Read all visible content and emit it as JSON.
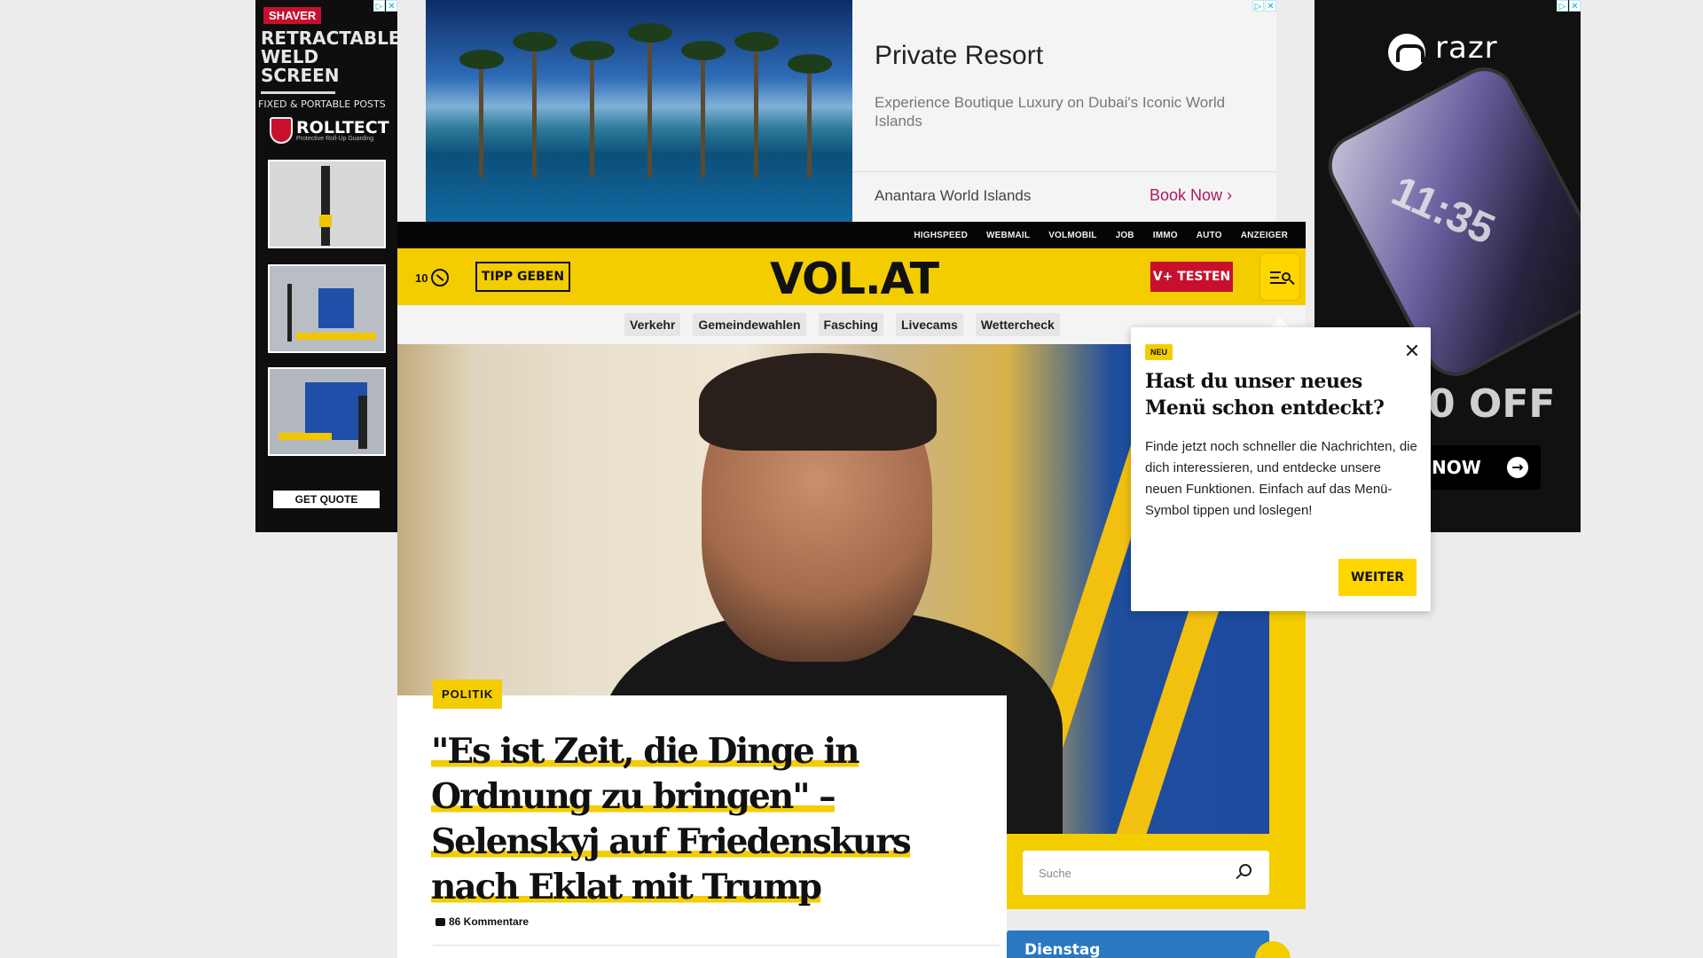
{
  "left_ad": {
    "brand": "SHAVER",
    "headline": "RETRACTABLE WELD SCREEN",
    "subline": "FIXED & PORTABLE POSTS",
    "logo": "ROLLTECT",
    "logo_tag": "Protective Roll-Up Guarding",
    "cta": "GET QUOTE"
  },
  "top_ad": {
    "title": "Private Resort",
    "description": "Experience Boutique Luxury on Dubai's Iconic World Islands",
    "advertiser": "Anantara World Islands",
    "cta": "Book Now"
  },
  "right_ad": {
    "brand": "razr",
    "clock": "11:35",
    "offer": "0 OFF",
    "cta": "NOW"
  },
  "top_nav": [
    "HIGHSPEED",
    "WEBMAIL",
    "VOLMOBIL",
    "JOB",
    "IMMO",
    "AUTO",
    "ANZEIGER"
  ],
  "header": {
    "count": "10",
    "tipp": "TIPP GEBEN",
    "logo": "VOL.AT",
    "vplus": "V+ TESTEN"
  },
  "sub_nav": [
    "Verkehr",
    "Gemeindewahlen",
    "Fasching",
    "Livecams",
    "Wettercheck"
  ],
  "popup": {
    "badge": "NEU",
    "title": "Hast du unser neues Menü schon entdeckt?",
    "body": "Finde jetzt noch schneller die Nachrichten, die dich interessieren, und entdecke unsere neuen Funktionen. Einfach auf das Menü-Symbol tippen und loslegen!",
    "button": "WEITER"
  },
  "article": {
    "category": "POLITIK",
    "headline": "\"Es ist Zeit, die Dinge in Ordnung zu bringen\" – Selenskyj auf Friedenskurs nach Eklat mit Trump",
    "comments": "86 Kommentare"
  },
  "search": {
    "placeholder": "Suche"
  },
  "weather": {
    "day": "Dienstag"
  },
  "colors": {
    "brand_yellow": "#f3cd00",
    "vplus_red": "#c8102e",
    "weather_blue": "#2a78c2"
  }
}
